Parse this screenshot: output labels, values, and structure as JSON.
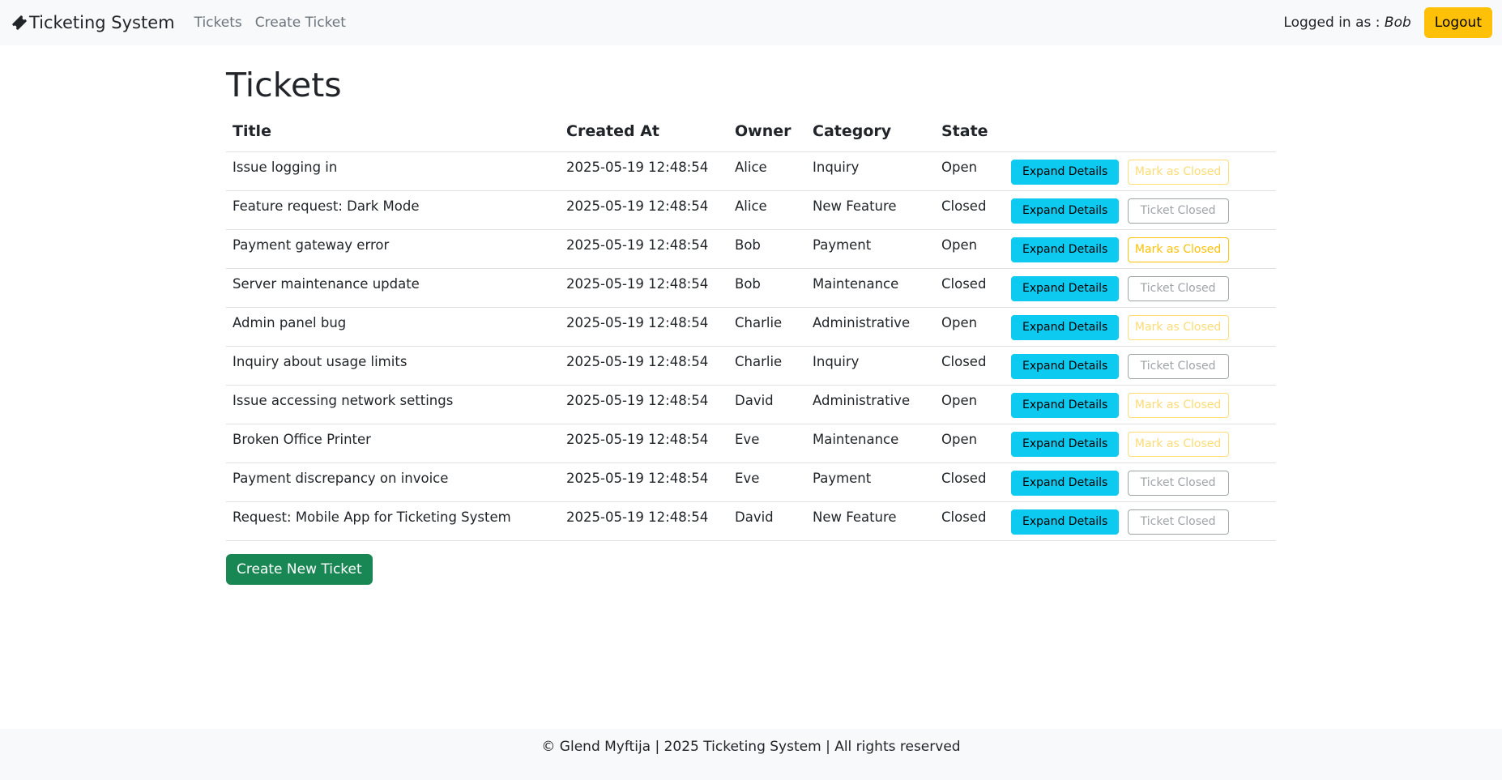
{
  "navbar": {
    "brand": "Ticketing System",
    "brand_icon": "ticket-icon",
    "links": [
      "Tickets",
      "Create Ticket"
    ],
    "logged_in_label": "Logged in as :",
    "user": "Bob",
    "logout_label": "Logout"
  },
  "main": {
    "title": "Tickets",
    "columns": [
      "Title",
      "Created At",
      "Owner",
      "Category",
      "State"
    ],
    "rows": [
      {
        "title": "Issue logging in",
        "created_at": "2025-05-19 12:48:54",
        "owner": "Alice",
        "category": "Inquiry",
        "state": "Open",
        "expand_label": "Expand Details",
        "state_button": "Mark as Closed"
      },
      {
        "title": "Feature request: Dark Mode",
        "created_at": "2025-05-19 12:48:54",
        "owner": "Alice",
        "category": "New Feature",
        "state": "Closed",
        "expand_label": "Expand Details",
        "state_button": "Ticket Closed"
      },
      {
        "title": "Payment gateway error",
        "created_at": "2025-05-19 12:48:54",
        "owner": "Bob",
        "category": "Payment",
        "state": "Open",
        "expand_label": "Expand Details",
        "state_button": "Mark as Closed"
      },
      {
        "title": "Server maintenance update",
        "created_at": "2025-05-19 12:48:54",
        "owner": "Bob",
        "category": "Maintenance",
        "state": "Closed",
        "expand_label": "Expand Details",
        "state_button": "Ticket Closed"
      },
      {
        "title": "Admin panel bug",
        "created_at": "2025-05-19 12:48:54",
        "owner": "Charlie",
        "category": "Administrative",
        "state": "Open",
        "expand_label": "Expand Details",
        "state_button": "Mark as Closed"
      },
      {
        "title": "Inquiry about usage limits",
        "created_at": "2025-05-19 12:48:54",
        "owner": "Charlie",
        "category": "Inquiry",
        "state": "Closed",
        "expand_label": "Expand Details",
        "state_button": "Ticket Closed"
      },
      {
        "title": "Issue accessing network settings",
        "created_at": "2025-05-19 12:48:54",
        "owner": "David",
        "category": "Administrative",
        "state": "Open",
        "expand_label": "Expand Details",
        "state_button": "Mark as Closed"
      },
      {
        "title": "Broken Office Printer",
        "created_at": "2025-05-19 12:48:54",
        "owner": "Eve",
        "category": "Maintenance",
        "state": "Open",
        "expand_label": "Expand Details",
        "state_button": "Mark as Closed"
      },
      {
        "title": "Payment discrepancy on invoice",
        "created_at": "2025-05-19 12:48:54",
        "owner": "Eve",
        "category": "Payment",
        "state": "Closed",
        "expand_label": "Expand Details",
        "state_button": "Ticket Closed"
      },
      {
        "title": "Request: Mobile App for Ticketing System",
        "created_at": "2025-05-19 12:48:54",
        "owner": "David",
        "category": "New Feature",
        "state": "Closed",
        "expand_label": "Expand Details",
        "state_button": "Ticket Closed"
      }
    ],
    "create_button": "Create New Ticket"
  },
  "footer": {
    "text": "© Glend Myftija | 2025 Ticketing System | All rights reserved"
  },
  "colors": {
    "navbar_bg": "#f8f9fa",
    "info": "#0dcaf0",
    "warning": "#ffc107",
    "success": "#198754",
    "secondary": "#6c757d"
  }
}
